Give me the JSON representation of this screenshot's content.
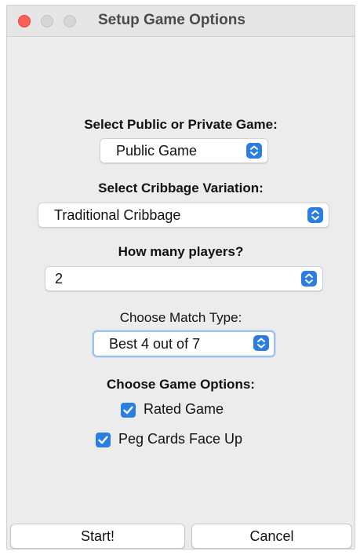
{
  "window": {
    "title": "Setup Game Options"
  },
  "game_visibility": {
    "label": "Select Public or Private Game:",
    "selected": "Public Game"
  },
  "variation": {
    "label": "Select Cribbage Variation:",
    "selected": "Traditional Cribbage"
  },
  "players": {
    "label": "How many players?",
    "selected": "2"
  },
  "match_type": {
    "label": "Choose Match Type:",
    "selected": "Best 4 out of 7"
  },
  "game_options": {
    "label": "Choose Game Options:",
    "rated_label": "Rated Game",
    "rated_checked": true,
    "peg_label": "Peg Cards Face Up",
    "peg_checked": true
  },
  "buttons": {
    "start": "Start!",
    "cancel": "Cancel"
  },
  "colors": {
    "accent": "#2a7de1",
    "close": "#fe5f57",
    "window_bg": "#ececec"
  },
  "icons": {
    "select_indicator": "chevron-up-down-icon",
    "checkbox": "checkmark-icon"
  }
}
